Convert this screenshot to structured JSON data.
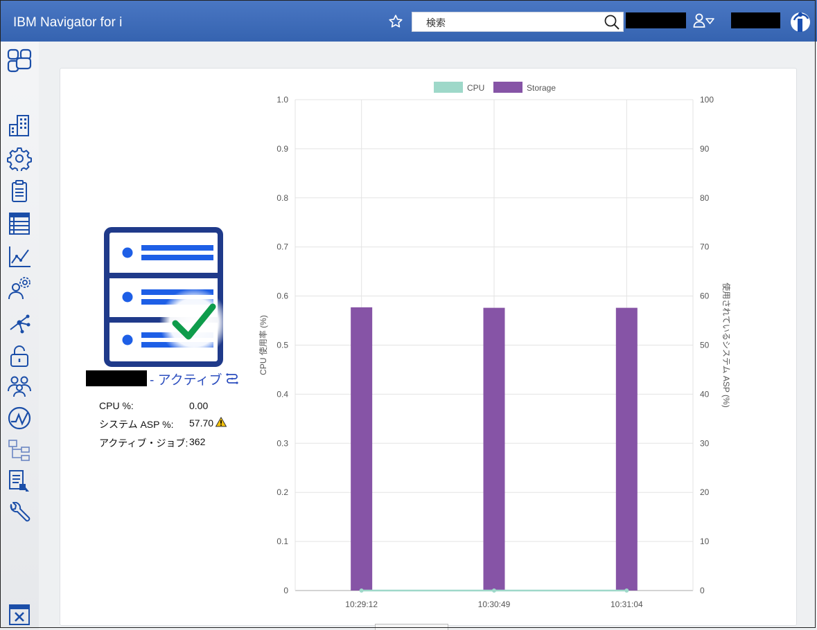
{
  "header": {
    "app_title": "IBM Navigator for i",
    "search_placeholder": "検索",
    "brand_color": "#3a68b5"
  },
  "sidebar": {
    "items": [
      {
        "icon": "dashboard-icon"
      },
      {
        "icon": "building-icon"
      },
      {
        "icon": "gear-icon"
      },
      {
        "icon": "clipboard-icon"
      },
      {
        "icon": "list-icon"
      },
      {
        "icon": "line-chart-icon"
      },
      {
        "icon": "user-settings-icon"
      },
      {
        "icon": "network-icon"
      },
      {
        "icon": "lock-icon"
      },
      {
        "icon": "users-icon"
      },
      {
        "icon": "performance-icon"
      },
      {
        "icon": "hierarchy-icon"
      },
      {
        "icon": "document-edit-icon"
      },
      {
        "icon": "wrench-icon"
      },
      {
        "icon": "calendar-icon"
      }
    ]
  },
  "system": {
    "status": "- アクティブ",
    "metrics": [
      {
        "label": "CPU %:",
        "value": "0.00"
      },
      {
        "label": "システム ASP %:",
        "value": "57.70"
      },
      {
        "label": "アクティブ・ジョブ:",
        "value": "362"
      }
    ],
    "warning_icon": "warning-icon",
    "ok_color": "#0e9c4b"
  },
  "chart_data": {
    "type": "bar",
    "legend": [
      "CPU",
      "Storage"
    ],
    "legend_position": "top-center",
    "categories": [
      "10:29:12",
      "10:30:49",
      "10:31:04"
    ],
    "series": [
      {
        "name": "CPU",
        "type": "line",
        "axis": "left",
        "values": [
          0,
          0,
          0
        ],
        "color": "#9ed8c9"
      },
      {
        "name": "Storage",
        "type": "bar",
        "axis": "right",
        "values": [
          57.7,
          57.6,
          57.6
        ],
        "color": "#8654a6"
      }
    ],
    "ylabel": "CPU 使用率 (%)",
    "ylabel_right": "使用されているシステム ASP (%)",
    "ylim": [
      0,
      1.0
    ],
    "ylim_right": [
      0,
      100
    ],
    "yticks": [
      "0",
      "0.1",
      "0.2",
      "0.3",
      "0.4",
      "0.5",
      "0.6",
      "0.7",
      "0.8",
      "0.9",
      "1.0"
    ],
    "yticks_right": [
      "0",
      "10",
      "20",
      "30",
      "40",
      "50",
      "60",
      "70",
      "80",
      "90",
      "100"
    ],
    "grid": true
  }
}
